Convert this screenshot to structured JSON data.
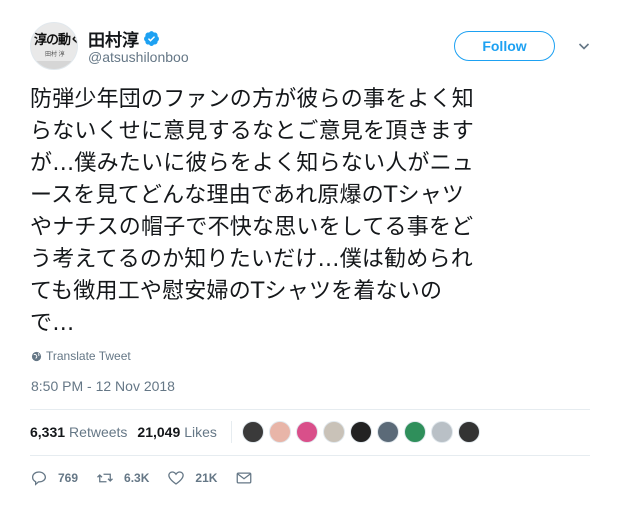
{
  "user": {
    "display_name": "田村淳",
    "handle": "@atsushilonboo",
    "avatar_text": "淳の動く",
    "avatar_sub": "田村 淳",
    "follow_label": "Follow"
  },
  "tweet": {
    "lines": [
      "防弾少年団のファンの方が彼らの事をよく知",
      "らないくせに意見するなとご意見を頂きます",
      "が…僕みたいに彼らをよく知らない人がニュ",
      "ースを見てどんな理由であれ原爆のTシャツ",
      "やナチスの帽子で不快な思いをしてる事をど",
      "う考えてるのか知りたいだけ…僕は勧められ",
      "ても徴用工や慰安婦のTシャツを着ないの",
      "で…"
    ],
    "translate_label": "Translate Tweet",
    "timestamp": "8:50 PM - 12 Nov 2018"
  },
  "stats": {
    "retweets_count": "6,331",
    "retweets_label": "Retweets",
    "likes_count": "21,049",
    "likes_label": "Likes",
    "liker_colors": [
      "#3a3a3a",
      "#e8b5a8",
      "#d94f8a",
      "#c9c2b8",
      "#222222",
      "#5b6a78",
      "#2f8f5b",
      "#b9c0c6",
      "#333333"
    ]
  },
  "actions": {
    "reply_count": "769",
    "retweet_count": "6.3K",
    "like_count": "21K"
  },
  "colors": {
    "accent": "#1da1f2",
    "muted": "#657786"
  }
}
